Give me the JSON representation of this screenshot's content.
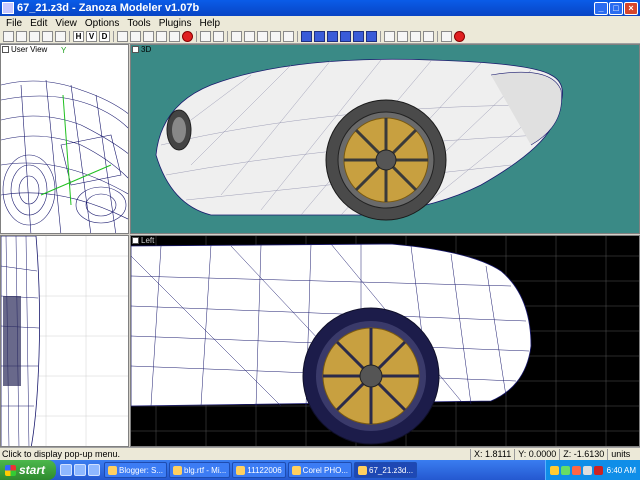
{
  "window": {
    "title": "67_21.z3d - Zanoza Modeler v1.07b",
    "controls": [
      "_",
      "□",
      "×"
    ]
  },
  "menu": [
    "File",
    "Edit",
    "View",
    "Options",
    "Tools",
    "Plugins",
    "Help"
  ],
  "toolbar": {
    "view_letters": [
      "H",
      "V",
      "D"
    ]
  },
  "viewports": {
    "user": {
      "label": "User View",
      "axis_label": "Y"
    },
    "perspective": {
      "label": "3D"
    },
    "front": {
      "label": ""
    },
    "left": {
      "label": "Left"
    }
  },
  "status": {
    "message": "Click to display pop-up menu.",
    "x": "X: 1.8111",
    "y": "Y: 0.0000",
    "z": "Z: -1.6130",
    "units": "units"
  },
  "taskbar": {
    "start_label": "start",
    "tasks": [
      {
        "label": "Blogger: S...",
        "active": false
      },
      {
        "label": "blg.rtf - Mi...",
        "active": false
      },
      {
        "label": "11122006",
        "active": false
      },
      {
        "label": "Corel PHO...",
        "active": false
      },
      {
        "label": "67_21.z3d...",
        "active": true
      }
    ],
    "clock": "6:40 AM"
  },
  "colors": {
    "viewport_3d_bg": "#3a8a86",
    "wireframe": "#1a1a6e",
    "wheel_gold": "#c8a040"
  }
}
